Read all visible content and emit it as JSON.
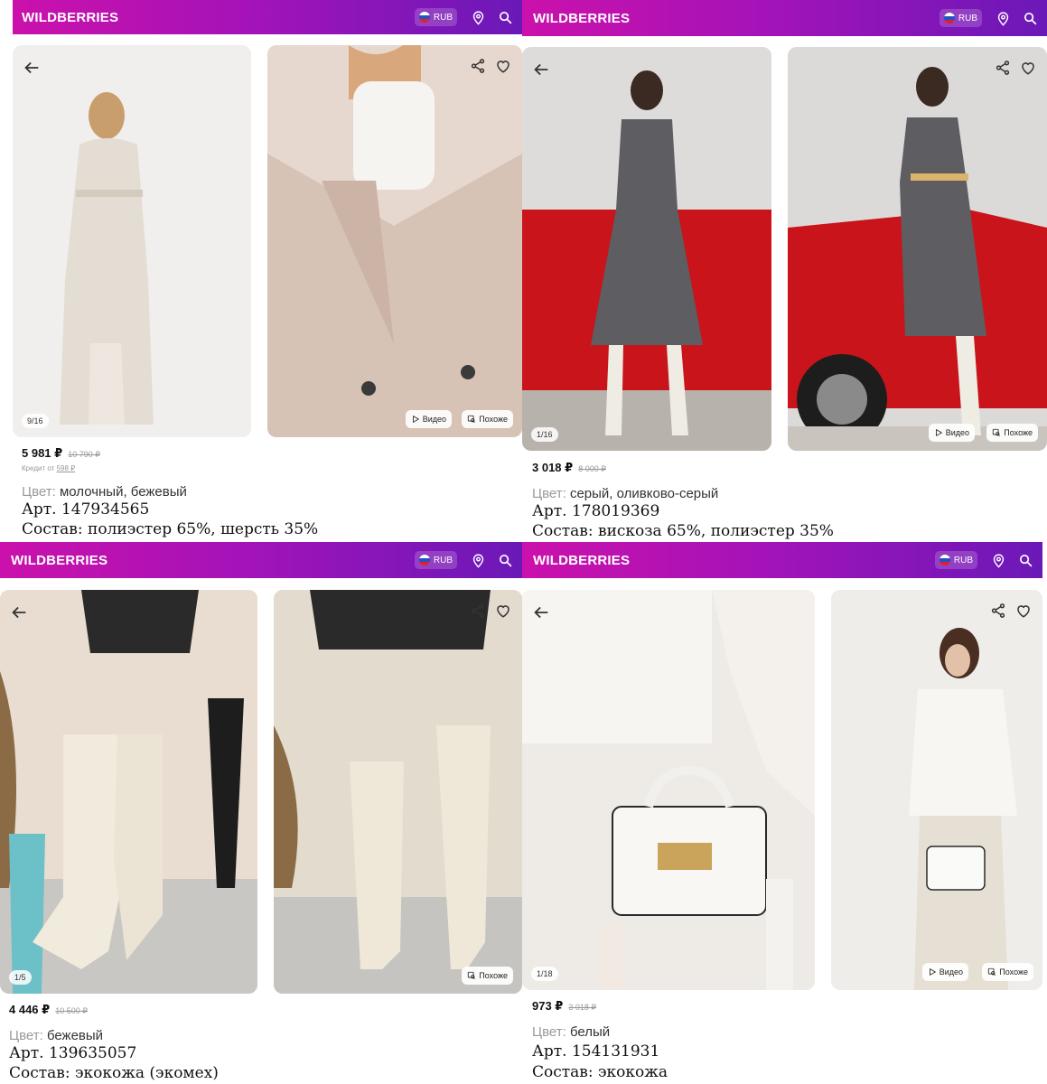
{
  "app": {
    "logo": "WILDBERRIES",
    "currency": "RUB"
  },
  "chips": {
    "video": "Видео",
    "similar": "Похоже"
  },
  "labels": {
    "color": "Цвет:"
  },
  "products": [
    {
      "counter": "9/16",
      "price": "5 981 ₽",
      "old_price": "10 790 ₽",
      "credit_label": "Кредит от",
      "credit_value": "598 ₽",
      "color": "молочный, бежевый",
      "article": "Арт. 147934565",
      "composition": "Состав: полиэстер 65%, шерсть 35%"
    },
    {
      "counter": "1/16",
      "price": "3 018 ₽",
      "old_price": "8 000 ₽",
      "color": "серый, оливково-серый",
      "article": "Арт. 178019369",
      "composition": "Состав: вискоза 65%, полиэстер 35%"
    },
    {
      "counter": "1/5",
      "price": "4 446 ₽",
      "old_price": "10 500 ₽",
      "color": "бежевый",
      "article": "Арт. 139635057",
      "composition": "Состав: экокожа (экомех)"
    },
    {
      "counter": "1/18",
      "price": "973 ₽",
      "old_price": "3 018 ₽",
      "color": "белый",
      "article": "Арт. 154131931",
      "composition": "Состав: экокожа"
    }
  ],
  "colors": {
    "brand_start": "#cb11ab",
    "brand_end": "#6b18b8"
  },
  "icons": [
    "back-arrow-icon",
    "share-icon",
    "heart-icon",
    "location-pin-icon",
    "search-icon",
    "play-icon",
    "similar-icon",
    "russia-flag-icon"
  ]
}
